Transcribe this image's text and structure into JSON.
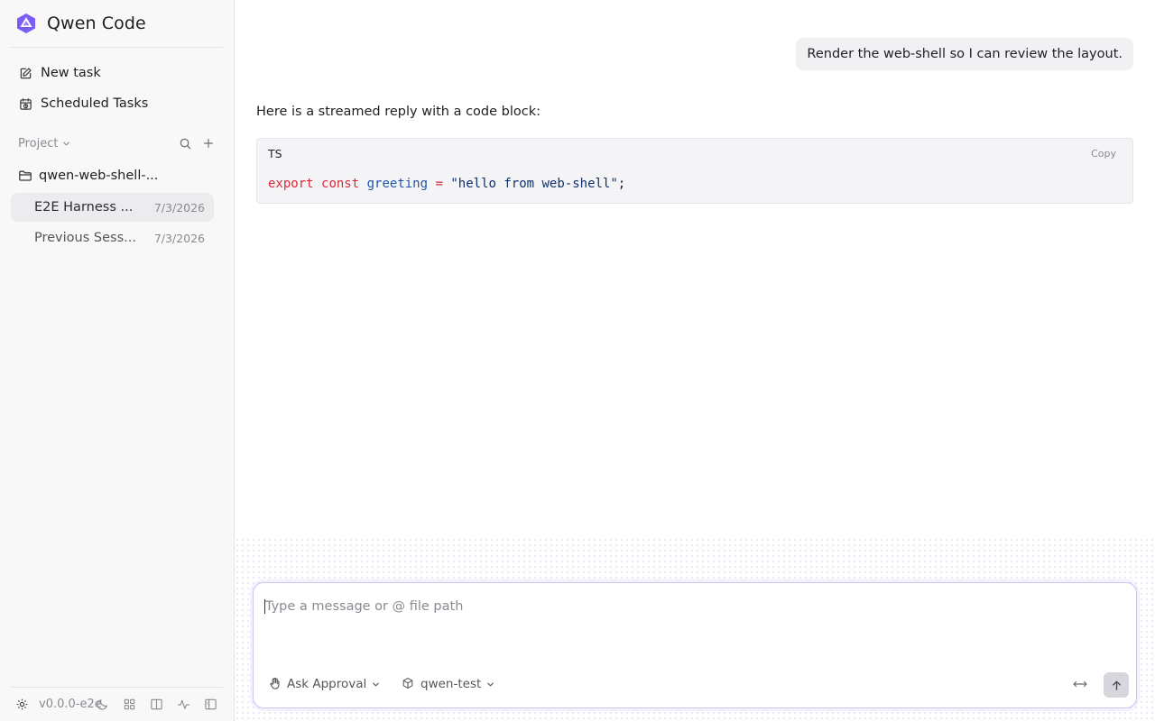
{
  "app": {
    "title": "Qwen Code",
    "accent": "#7b5cf5"
  },
  "sidebar": {
    "nav": [
      {
        "label": "New task",
        "icon": "edit-icon"
      },
      {
        "label": "Scheduled Tasks",
        "icon": "calendar-clock-icon"
      }
    ],
    "project_label": "Project",
    "folder": {
      "label": "qwen-web-shell-..."
    },
    "sessions": [
      {
        "name": "E2E Harness ...",
        "date": "7/3/2026",
        "active": true
      },
      {
        "name": "Previous Sess...",
        "date": "7/3/2026",
        "active": false
      }
    ],
    "footer": {
      "version": "v0.0.0-e2e"
    }
  },
  "chat": {
    "user_message": "Render the web-shell so I can review the layout.",
    "assistant_text": "Here is a streamed reply with a code block:",
    "code_block": {
      "lang": "TS",
      "copy_label": "Copy",
      "tokens": {
        "kw1": "export",
        "kw2": "const",
        "ident": "greeting",
        "op": "=",
        "str": "\"hello from web-shell\"",
        "punct": ";"
      }
    }
  },
  "composer": {
    "placeholder": "Type a message or @ file path",
    "mode_label": "Ask Approval",
    "model_label": "qwen-test"
  }
}
